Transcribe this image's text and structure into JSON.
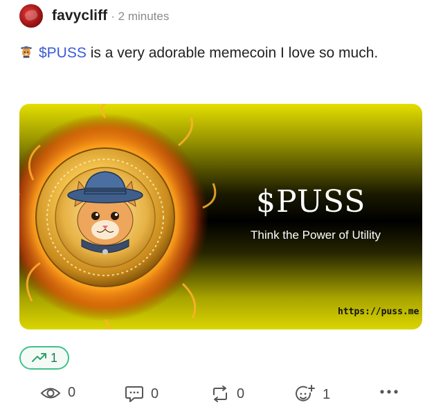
{
  "post": {
    "author": {
      "username": "favycliff",
      "timestamp": "· 2 minutes"
    },
    "body": {
      "ticker": "$PUSS",
      "text": " is a very adorable memecoin I love so much."
    },
    "media": {
      "title": "$PUSS",
      "tagline": "Think the Power of Utility",
      "url": "https://puss.me"
    },
    "trend_badge": {
      "count": "1",
      "icon": "trending-up-icon"
    },
    "actions": {
      "views": "0",
      "comments": "0",
      "reposts": "0",
      "reactions": "1"
    }
  },
  "colors": {
    "link": "#3a5bd6",
    "badge_border": "#3fc18a",
    "coin_gold": "#e8b53a",
    "banner_yellow": "#e3df00"
  }
}
